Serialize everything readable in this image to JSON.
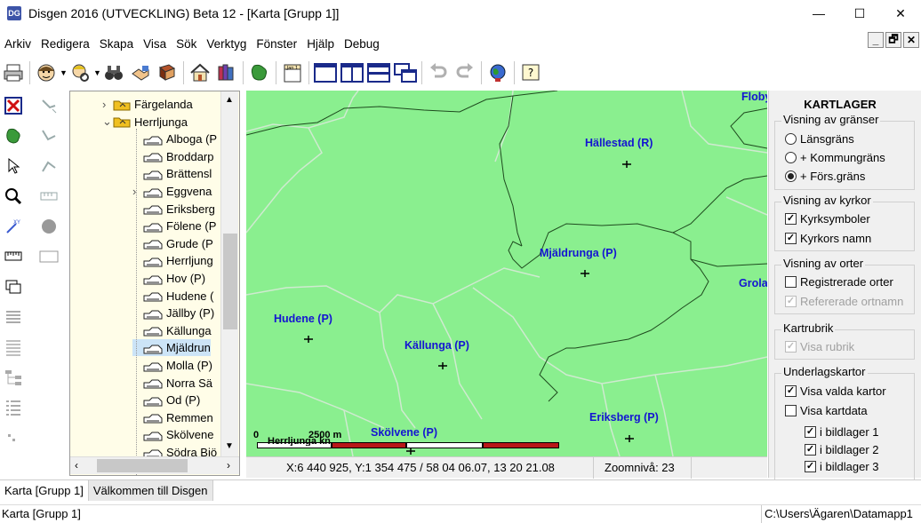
{
  "window": {
    "title": "Disgen 2016 (UTVECKLING) Beta 12 - [Karta [Grupp 1]]",
    "app_icon_text": "DG",
    "minimize": "—",
    "maximize": "☐",
    "close": "✕"
  },
  "menu": [
    "Arkiv",
    "Redigera",
    "Skapa",
    "Visa",
    "Sök",
    "Verktyg",
    "Fönster",
    "Hjälp",
    "Debug"
  ],
  "mdi": {
    "minimize": "_",
    "restore": "🗗",
    "close": "✕"
  },
  "toolbar": {
    "icons": [
      "printer-icon",
      "person-icon",
      "person-search-icon",
      "binoculars-icon",
      "handshake-icon",
      "book-icon",
      "home-icon",
      "books-icon",
      "map-icon",
      "calendar-icon",
      "layout-single-icon",
      "layout-split-vertical-icon",
      "layout-split-horizontal-icon",
      "layout-cascade-icon",
      "undo-icon",
      "redo-icon",
      "globe-icon",
      "help-icon"
    ],
    "calendar_label": "Jan 1",
    "help_label": "?"
  },
  "tree": {
    "items": [
      {
        "label": "Färgelanda",
        "level": 1,
        "expander": "›"
      },
      {
        "label": "Herrljunga",
        "level": 1,
        "expander": "⌄"
      },
      {
        "label": "Alboga (P",
        "level": 2,
        "expander": ""
      },
      {
        "label": "Broddarp",
        "level": 2,
        "expander": ""
      },
      {
        "label": "Brättensl",
        "level": 2,
        "expander": ""
      },
      {
        "label": "Eggvena",
        "level": 2,
        "expander": "›"
      },
      {
        "label": "Eriksberg",
        "level": 2,
        "expander": ""
      },
      {
        "label": "Fölene (P",
        "level": 2,
        "expander": ""
      },
      {
        "label": "Grude (P",
        "level": 2,
        "expander": ""
      },
      {
        "label": "Herrljung",
        "level": 2,
        "expander": ""
      },
      {
        "label": "Hov (P)",
        "level": 2,
        "expander": ""
      },
      {
        "label": "Hudene (",
        "level": 2,
        "expander": ""
      },
      {
        "label": "Jällby (P)",
        "level": 2,
        "expander": ""
      },
      {
        "label": "Källunga",
        "level": 2,
        "expander": ""
      },
      {
        "label": "Mjäldrun",
        "level": 2,
        "expander": "",
        "selected": true
      },
      {
        "label": "Molla (P)",
        "level": 2,
        "expander": ""
      },
      {
        "label": "Norra Sä",
        "level": 2,
        "expander": ""
      },
      {
        "label": "Od (P)",
        "level": 2,
        "expander": ""
      },
      {
        "label": "Remmen",
        "level": 2,
        "expander": ""
      },
      {
        "label": "Skölvene",
        "level": 2,
        "expander": ""
      },
      {
        "label": "Södra Bjö",
        "level": 2,
        "expander": ""
      }
    ]
  },
  "map": {
    "background": "#8aef8f",
    "labels": [
      "Floby",
      "Hällestad (R)",
      "Mjäldrunga (P)",
      "Grolanda",
      "Hudene (P)",
      "Källunga (P)",
      "Eriksberg (P)",
      "Skölvene (P)"
    ],
    "scale_left": "0",
    "scale_mid": "2500 m",
    "scale_caption": "Herrljunga kn",
    "coords": "X:6 440 925, Y:1 354 475 / 58 04 06.07, 13 20 21.08",
    "zoom": "Zoomnivå: 23"
  },
  "panel": {
    "title": "KARTLAGER",
    "borders_group": "Visning av gränser",
    "borders_options": [
      "Länsgräns",
      "+ Kommungräns",
      "+ Förs.gräns"
    ],
    "borders_selected": 2,
    "churches_group": "Visning av kyrkor",
    "church_symbols": "Kyrksymboler",
    "church_names": "Kyrkors namn",
    "places_group": "Visning av orter",
    "registered_places": "Registrerade orter",
    "referenced_names": "Refererade ortnamn",
    "map_title_group": "Kartrubrik",
    "show_title": "Visa rubrik",
    "underlay_group": "Underlagskartor",
    "show_selected_maps": "Visa valda kartor",
    "show_map_data": "Visa kartdata",
    "layer1": "i bildlager 1",
    "layer2": "i bildlager 2",
    "layer3": "i bildlager 3",
    "check_mark": "✓"
  },
  "tabs": [
    "Karta [Grupp 1]",
    "Välkommen till Disgen"
  ],
  "status": {
    "left": "Karta [Grupp 1]",
    "right": "C:\\Users\\Ägaren\\Datamapp1"
  }
}
